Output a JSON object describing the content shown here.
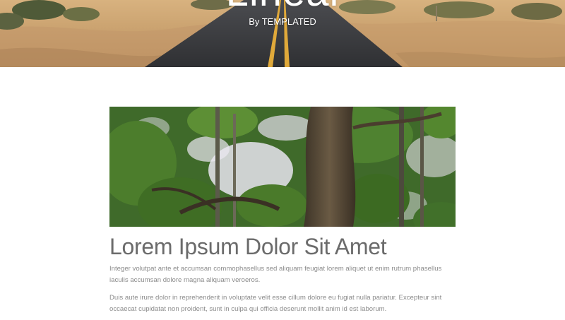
{
  "header": {
    "title": "Lineal",
    "subtitle": "By TEMPLATED"
  },
  "article": {
    "image_subject": "forest-trees-photo",
    "title": "Lorem Ipsum Dolor Sit Amet",
    "paragraphs": [
      "Integer volutpat ante et accumsan commophasellus sed aliquam feugiat lorem aliquet ut enim rutrum phasellus iaculis accumsan dolore magna aliquam veroeros.",
      "Duis aute irure dolor in reprehenderit in voluptate velit esse cillum dolore eu fugiat nulla pariatur. Excepteur sint occaecat cupidatat non proident, sunt in culpa qui officia deserunt mollit anim id est laborum."
    ]
  },
  "colors": {
    "sand": "#c99f6e",
    "road": "#3a3a3d",
    "road_line": "#e0a93a",
    "foliage": "#4c7d2c",
    "title_text": "#6b6b6b",
    "body_text": "#8c8c8c"
  }
}
